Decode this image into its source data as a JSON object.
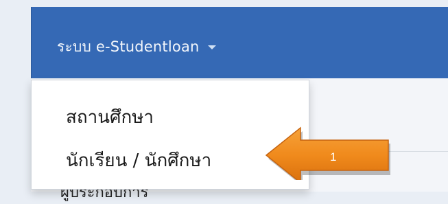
{
  "navbar": {
    "menu_label": "ระบบ e-Studentloan",
    "caret_icon": "caret-down-icon",
    "color": "#3569b5"
  },
  "dropdown": {
    "items": [
      {
        "label": "สถานศึกษา"
      },
      {
        "label": "นักเรียน / นักศึกษา"
      }
    ]
  },
  "background_text": "ผู้ประกอบการ",
  "callout": {
    "number": "1",
    "arrow_icon": "left-arrow-icon",
    "color": "#f08a1c"
  }
}
